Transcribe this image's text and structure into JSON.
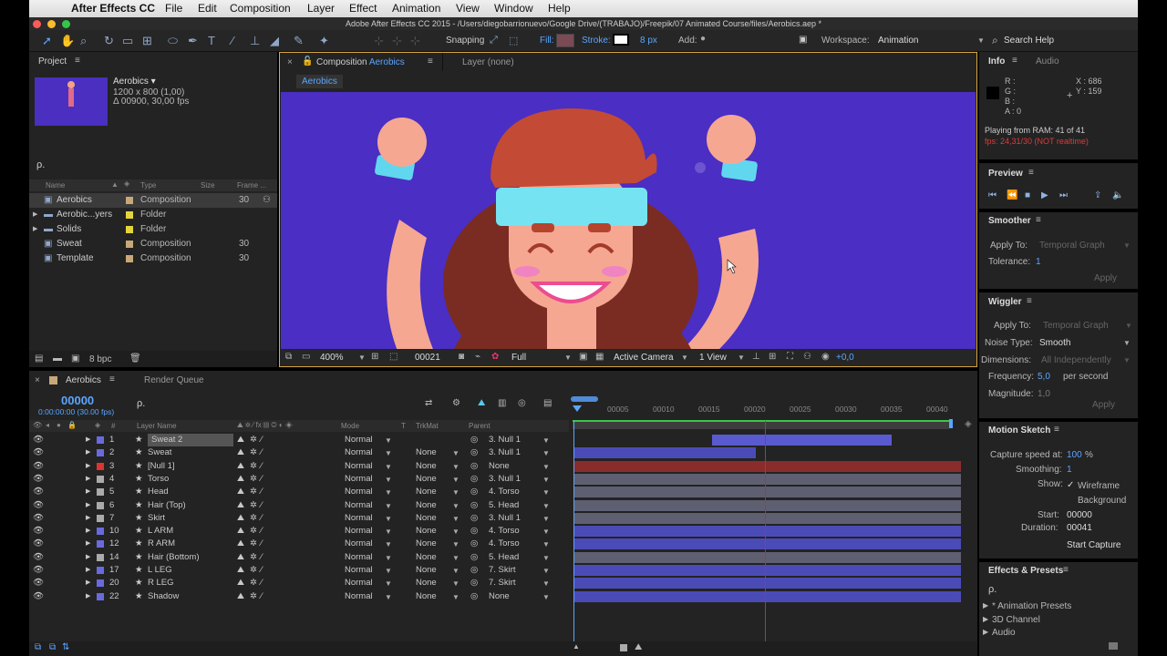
{
  "menubar": {
    "apple": "",
    "items": [
      "After Effects CC",
      "File",
      "Edit",
      "Composition",
      "Layer",
      "Effect",
      "Animation",
      "View",
      "Window",
      "Help"
    ]
  },
  "title": "Adobe After Effects CC 2015 - /Users/diegobarrionuevo/Google Drive/(TRABAJO)/Freepik/07 Animated Course/files/Aerobics.aep *",
  "toolbar": {
    "snapping": "Snapping",
    "fill": "Fill:",
    "stroke": "Stroke:",
    "px": "8 px",
    "add": "Add:",
    "workspace_label": "Workspace:",
    "workspace": "Animation",
    "search": "Search Help"
  },
  "project": {
    "tab": "Project",
    "name": "Aerobics ▾",
    "size": "1200 x 800 (1,00)",
    "dur": "Δ 00900, 30,00 fps",
    "search": "ρ.",
    "cols": [
      "Name",
      "Type",
      "Size",
      "Frame ..."
    ],
    "items": [
      {
        "name": "Aerobics",
        "type": "Composition",
        "frames": "30",
        "color": "#c8a878"
      },
      {
        "name": "Aerobic...yers",
        "type": "Folder",
        "frames": "",
        "color": "#e5d53a"
      },
      {
        "name": "Solids",
        "type": "Folder",
        "frames": "",
        "color": "#e5d53a"
      },
      {
        "name": "Sweat",
        "type": "Composition",
        "frames": "30",
        "color": "#c8a878"
      },
      {
        "name": "Template",
        "type": "Composition",
        "frames": "30",
        "color": "#c8a878"
      }
    ],
    "bpc": "8 bpc"
  },
  "comp": {
    "tab": "Composition",
    "tabname": "Aerobics",
    "layer_tab": "Layer (none)",
    "crumb": "Aerobics",
    "zoom": "400%",
    "frame": "00021",
    "res": "Full",
    "camera": "Active Camera",
    "view": "1 View",
    "exposure": "+0,0",
    "bg": "#4a2fc0"
  },
  "info": {
    "tab": "Info",
    "audio_tab": "Audio",
    "r": "R :",
    "g": "G :",
    "b": "B :",
    "a": "A : 0",
    "x": "X : 686",
    "y": "Y : 159",
    "playing": "Playing from RAM: 41 of 41",
    "fps": "fps: 24,31/30 (NOT realtime)"
  },
  "preview": {
    "title": "Preview"
  },
  "smoother": {
    "title": "Smoother",
    "apply_label": "Apply To:",
    "apply_val": "Temporal Graph",
    "tol_label": "Tolerance:",
    "tol_val": "1",
    "apply_btn": "Apply"
  },
  "wiggler": {
    "title": "Wiggler",
    "apply_label": "Apply To:",
    "apply_val": "Temporal Graph",
    "noise_label": "Noise Type:",
    "noise_val": "Smooth",
    "dim_label": "Dimensions:",
    "dim_val": "All Independently",
    "freq_label": "Frequency:",
    "freq_val": "5,0",
    "freq_unit": "per second",
    "mag_label": "Magnitude:",
    "mag_val": "1,0",
    "apply_btn": "Apply"
  },
  "motion": {
    "title": "Motion Sketch",
    "cap_label": "Capture speed at:",
    "cap_val": "100",
    "cap_unit": "%",
    "smooth_label": "Smoothing:",
    "smooth_val": "1",
    "show_label": "Show:",
    "wire": "Wireframe",
    "bgd": "Background",
    "start_label": "Start:",
    "start_val": "00000",
    "dur_label": "Duration:",
    "dur_val": "00041",
    "btn": "Start Capture"
  },
  "effects": {
    "title": "Effects & Presets",
    "search": "ρ.",
    "items": [
      "* Animation Presets",
      "3D Channel",
      "Audio"
    ]
  },
  "timeline": {
    "tab": "Aerobics",
    "render": "Render Queue",
    "timecode": "00000",
    "fps": "0:00:00:00 (30.00 fps)",
    "search": "ρ.",
    "cols": {
      "layer": "Layer Name",
      "mode": "Mode",
      "t": "T",
      "trkmat": "TrkMat",
      "parent": "Parent"
    },
    "ruler": [
      "00005",
      "00010",
      "00015",
      "00020",
      "00025",
      "00030",
      "00035",
      "00040"
    ],
    "layers": [
      {
        "num": "1",
        "name": "Sweat 2",
        "mode": "Normal",
        "trk": "",
        "parent": "3. Null 1",
        "color": "#6a6adf",
        "barStart": 0.355,
        "barEnd": 0.82,
        "barColor": "#5a5ad0"
      },
      {
        "num": "2",
        "name": "Sweat",
        "mode": "Normal",
        "trk": "None",
        "parent": "3. Null 1",
        "color": "#6a6adf",
        "barStart": 0,
        "barEnd": 0.47,
        "barColor": "#4b4bb8"
      },
      {
        "num": "3",
        "name": "[Null 1]",
        "mode": "Normal",
        "trk": "None",
        "parent": "None",
        "color": "#d33",
        "barStart": 0,
        "barEnd": 1,
        "barColor": "#8a2c2c"
      },
      {
        "num": "4",
        "name": "Torso",
        "mode": "Normal",
        "trk": "None",
        "parent": "3. Null 1",
        "color": "#aaa",
        "barStart": 0,
        "barEnd": 1,
        "barColor": "#5f5f72"
      },
      {
        "num": "5",
        "name": "Head",
        "mode": "Normal",
        "trk": "None",
        "parent": "4. Torso",
        "color": "#aaa",
        "barStart": 0,
        "barEnd": 1,
        "barColor": "#5f5f72"
      },
      {
        "num": "6",
        "name": "Hair (Top)",
        "mode": "Normal",
        "trk": "None",
        "parent": "5. Head",
        "color": "#aaa",
        "barStart": 0,
        "barEnd": 1,
        "barColor": "#5f5f72"
      },
      {
        "num": "7",
        "name": "Skirt",
        "mode": "Normal",
        "trk": "None",
        "parent": "3. Null 1",
        "color": "#aaa",
        "barStart": 0,
        "barEnd": 1,
        "barColor": "#5f5f72"
      },
      {
        "num": "10",
        "name": "L ARM",
        "mode": "Normal",
        "trk": "None",
        "parent": "4. Torso",
        "color": "#6a6adf",
        "barStart": 0,
        "barEnd": 1,
        "barColor": "#4b4bb8"
      },
      {
        "num": "12",
        "name": "R ARM",
        "mode": "Normal",
        "trk": "None",
        "parent": "4. Torso",
        "color": "#6a6adf",
        "barStart": 0,
        "barEnd": 1,
        "barColor": "#4b4bb8"
      },
      {
        "num": "14",
        "name": "Hair (Bottom)",
        "mode": "Normal",
        "trk": "None",
        "parent": "5. Head",
        "color": "#aaa",
        "barStart": 0,
        "barEnd": 1,
        "barColor": "#5f5f72"
      },
      {
        "num": "17",
        "name": "L LEG",
        "mode": "Normal",
        "trk": "None",
        "parent": "7. Skirt",
        "color": "#6a6adf",
        "barStart": 0,
        "barEnd": 1,
        "barColor": "#4b4bb8"
      },
      {
        "num": "20",
        "name": "R LEG",
        "mode": "Normal",
        "trk": "None",
        "parent": "7. Skirt",
        "color": "#6a6adf",
        "barStart": 0,
        "barEnd": 1,
        "barColor": "#4b4bb8"
      },
      {
        "num": "22",
        "name": "Shadow",
        "mode": "Normal",
        "trk": "None",
        "parent": "None",
        "color": "#6a6adf",
        "barStart": 0,
        "barEnd": 1,
        "barColor": "#4b4bb8"
      }
    ]
  }
}
